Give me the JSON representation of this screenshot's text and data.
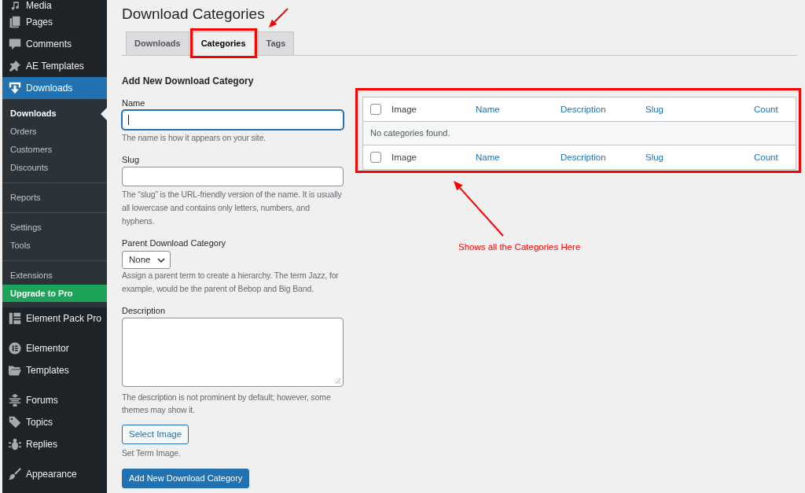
{
  "sidebar": {
    "groups": [
      [
        {
          "label": "Media",
          "selected": false
        },
        {
          "label": "Pages",
          "selected": false
        },
        {
          "label": "Comments",
          "selected": false
        },
        {
          "label": "AE Templates",
          "selected": false
        },
        {
          "label": "Downloads",
          "selected": true,
          "submenu": [
            [
              {
                "kind": "link",
                "label": "Downloads",
                "selected": true
              },
              {
                "kind": "link",
                "label": "Orders",
                "selected": false
              },
              {
                "kind": "link",
                "label": "Customers",
                "selected": false
              },
              {
                "kind": "link",
                "label": "Discounts",
                "selected": false
              }
            ],
            [
              {
                "kind": "link",
                "label": "Reports",
                "selected": false
              }
            ],
            [
              {
                "kind": "link",
                "label": "Settings",
                "selected": false
              },
              {
                "kind": "link",
                "label": "Tools",
                "selected": false
              }
            ],
            [
              {
                "kind": "link",
                "label": "Extensions",
                "selected": false
              },
              {
                "kind": "upgrade",
                "label": "Upgrade to Pro",
                "selected": false
              }
            ]
          ]
        },
        {
          "label": "Element Pack Pro",
          "selected": false
        }
      ],
      [
        {
          "label": "Elementor",
          "selected": false
        },
        {
          "label": "Templates",
          "selected": false
        }
      ],
      [
        {
          "label": "Forums",
          "selected": false
        },
        {
          "label": "Topics",
          "selected": false
        },
        {
          "label": "Replies",
          "selected": false
        }
      ],
      [
        {
          "label": "Appearance",
          "selected": false
        }
      ]
    ]
  },
  "page": {
    "title": "Download Categories"
  },
  "tabs": [
    {
      "label": "Downloads",
      "selected": false,
      "highlighted": false
    },
    {
      "label": "Categories",
      "selected": true,
      "highlighted": true
    },
    {
      "label": "Tags",
      "selected": false,
      "highlighted": false
    }
  ],
  "form": {
    "heading": "Add New Download Category",
    "fields": [
      {
        "kind": "text",
        "label": "Name",
        "focused": true,
        "hint": "The name is how it appears on your site."
      },
      {
        "kind": "text",
        "label": "Slug",
        "focused": false,
        "hint": "The “slug” is the URL-friendly version of the name. It is usually all lowercase and contains only letters, numbers, and hyphens."
      },
      {
        "kind": "select",
        "label": "Parent Download Category",
        "value": "None",
        "hint": "Assign a parent term to create a hierarchy. The term Jazz, for example, would be the parent of Bebop and Big Band."
      },
      {
        "kind": "textarea",
        "label": "Description",
        "focused": false,
        "hint": "The description is not prominent by default; however, some themes may show it."
      },
      {
        "kind": "image",
        "button": "Select Image",
        "hint": "Set Term Image."
      }
    ],
    "submit_button": "Add New Download Category"
  },
  "table": {
    "highlighted": true,
    "header": {
      "checked": false,
      "columns": [
        {
          "label": "Image",
          "sortable": false
        },
        {
          "label": "Name",
          "sortable": true
        },
        {
          "label": "Description",
          "sortable": true
        },
        {
          "label": "Slug",
          "sortable": true
        },
        {
          "label": "Count",
          "sortable": true
        }
      ]
    },
    "empty_message": "No categories found.",
    "footer": {
      "checked": false,
      "columns": [
        {
          "label": "Image",
          "sortable": false
        },
        {
          "label": "Name",
          "sortable": true
        },
        {
          "label": "Description",
          "sortable": true
        },
        {
          "label": "Slug",
          "sortable": true
        },
        {
          "label": "Count",
          "sortable": true
        }
      ]
    }
  },
  "callout": {
    "text": "Shows all the Categories Here"
  }
}
